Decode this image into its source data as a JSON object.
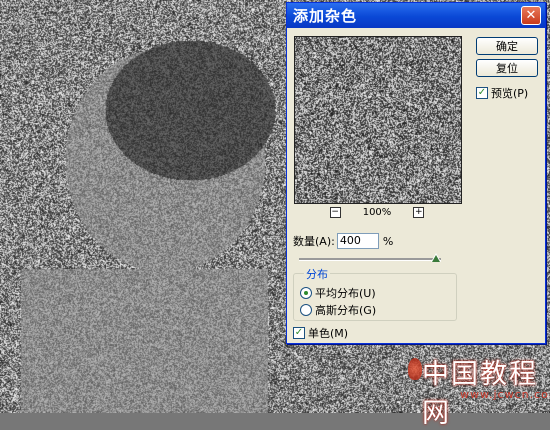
{
  "dialog": {
    "title": "添加杂色",
    "close_glyph": "✕",
    "ok_label": "确定",
    "reset_label": "复位",
    "preview_label": "预览(P)",
    "preview_checked": true,
    "zoom_out_glyph": "−",
    "zoom_in_glyph": "+",
    "zoom_level": "100%",
    "amount_label": "数量(A):",
    "amount_value": "400",
    "amount_unit": "%",
    "distribution_legend": "分布",
    "uniform_label": "平均分布(U)",
    "gaussian_label": "高斯分布(G)",
    "uniform_selected": true,
    "monochromatic_label": "单色(M)",
    "monochromatic_checked": true
  },
  "watermark": {
    "title": "中国教程网",
    "url": "www.jcwcn.com"
  },
  "colors": {
    "titlebar": "#0a48d6",
    "dialog_bg": "#ece9d8",
    "legend_text": "#0046d5",
    "watermark_red": "#c9382a"
  }
}
